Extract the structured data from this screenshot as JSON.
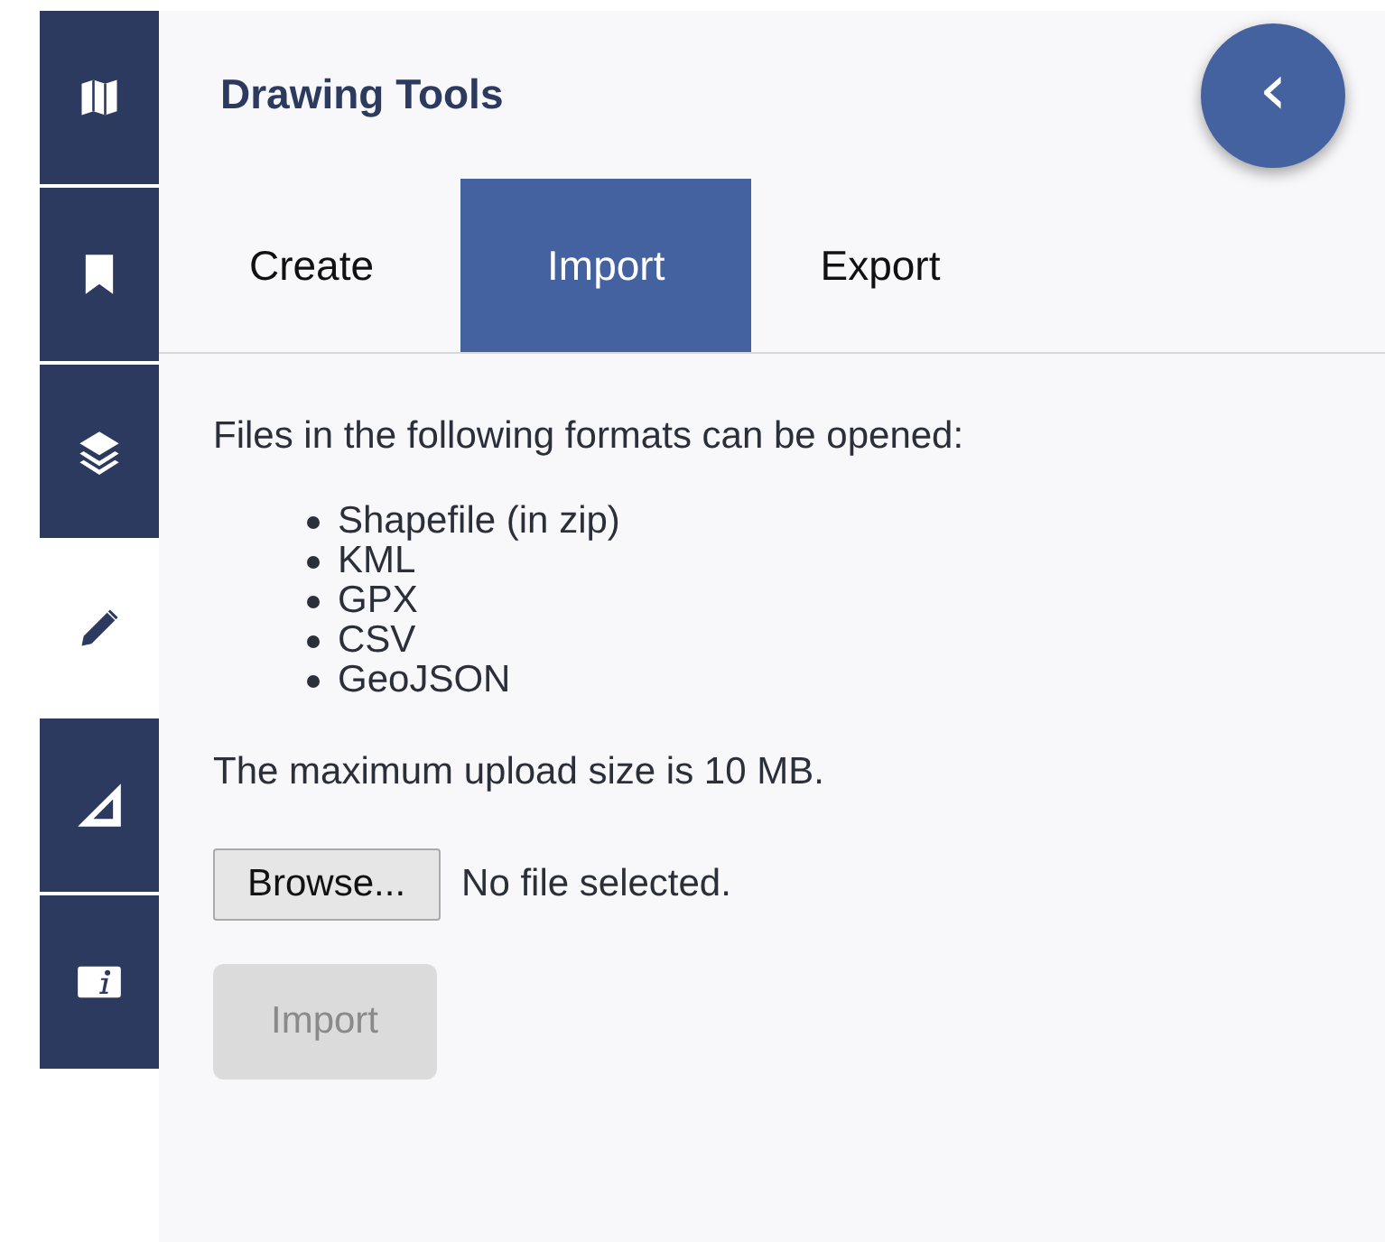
{
  "sidebar": {
    "items": [
      {
        "kind": "map",
        "selected": false
      },
      {
        "kind": "bookmark",
        "selected": false
      },
      {
        "kind": "layers",
        "selected": false
      },
      {
        "kind": "pencil",
        "selected": true
      },
      {
        "kind": "ruler",
        "selected": false
      },
      {
        "kind": "info",
        "selected": false
      }
    ]
  },
  "panel": {
    "title": "Drawing Tools",
    "collapse_button": "‹",
    "tabs": [
      {
        "label": "Create",
        "selected": false
      },
      {
        "label": "Import",
        "selected": true
      },
      {
        "label": "Export",
        "selected": false
      }
    ],
    "intro": "Files in the following formats can be opened:",
    "formats": [
      "Shapefile (in zip)",
      "KML",
      "GPX",
      "CSV",
      "GeoJSON"
    ],
    "limit_note": "The maximum upload size is 10 MB.",
    "file_input": {
      "button": "Browse...",
      "status": "No file selected."
    },
    "import_button": {
      "label": "Import",
      "disabled": true
    }
  }
}
